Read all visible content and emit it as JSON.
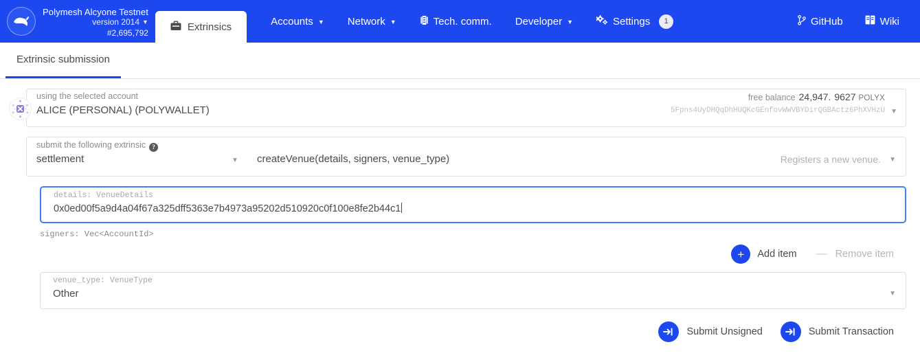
{
  "header": {
    "brand": {
      "name": "Polymesh Alcyone Testnet",
      "version": "version 2014",
      "block": "#2,695,792",
      "logo_icon": "polymesh-bull-logo"
    },
    "active_tab": {
      "label": "Extrinsics",
      "icon": "briefcase-icon"
    },
    "nav_items": [
      {
        "label": "Accounts",
        "icon": "",
        "caret": true,
        "badge": ""
      },
      {
        "label": "Network",
        "icon": "",
        "caret": true,
        "badge": ""
      },
      {
        "label": "Tech. comm.",
        "icon": "chip-icon",
        "caret": false,
        "badge": ""
      },
      {
        "label": "Developer",
        "icon": "",
        "caret": true,
        "badge": ""
      },
      {
        "label": "Settings",
        "icon": "gear-icon",
        "caret": false,
        "badge": "1"
      }
    ],
    "right_items": [
      {
        "label": "GitHub",
        "icon": "git-branch-icon"
      },
      {
        "label": "Wiki",
        "icon": "book-icon"
      }
    ]
  },
  "subtab": {
    "label": "Extrinsic submission"
  },
  "account": {
    "label": "using the selected account",
    "value": "ALICE (PERSONAL) (POLYWALLET)",
    "balance_label": "free balance",
    "balance_whole": "24,947.",
    "balance_frac": "9627",
    "balance_unit": "POLYX",
    "address": "5Fpns4UyDHQqDhHUQKcGEnfovWWVBYDirQGBActz6PhXVHzU",
    "identicon": "polkadot-identicon"
  },
  "extrinsic": {
    "label": "submit the following extrinsic",
    "help_icon": "question-mark-icon",
    "module": "settlement",
    "method": "createVenue(details, signers, venue_type)",
    "description": "Registers a new venue."
  },
  "fields": {
    "details": {
      "label": "details: VenueDetails",
      "value": "0x0ed00f5a9d4a04f67a325dff5363e7b4973a95202d510920c0f100e8fe2b44c1"
    },
    "signers": {
      "label": "signers: Vec<AccountId>"
    },
    "venue_type": {
      "label": "venue_type: VenueType",
      "value": "Other"
    }
  },
  "item_actions": {
    "add_label": "Add item",
    "add_icon": "plus-icon",
    "remove_label": "Remove item",
    "remove_icon": "minus-icon"
  },
  "submit": {
    "unsigned_label": "Submit Unsigned",
    "transaction_label": "Submit Transaction",
    "icon": "sign-in-arrow-icon"
  },
  "colors": {
    "brand_blue": "#1d48ef",
    "accent_blue": "#3f7ff5",
    "text": "#4a4a4a",
    "muted": "#8d8d8d"
  }
}
